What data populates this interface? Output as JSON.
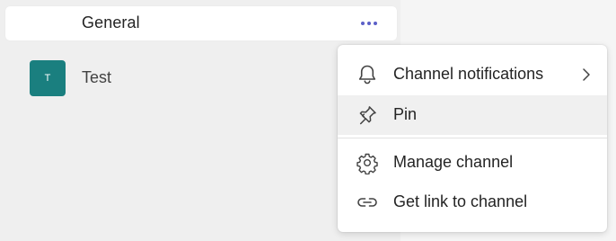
{
  "channels": {
    "general": {
      "name": "General",
      "more_icon": "more-horizontal-icon"
    }
  },
  "team": {
    "avatar_letter": "T",
    "name": "Test",
    "avatar_color": "#1a7f7f"
  },
  "context_menu": {
    "items": [
      {
        "label": "Channel notifications",
        "icon": "bell-icon",
        "has_submenu": true
      },
      {
        "label": "Pin",
        "icon": "pin-icon",
        "hovered": true
      },
      {
        "label": "Manage channel",
        "icon": "gear-icon"
      },
      {
        "label": "Get link to channel",
        "icon": "link-icon"
      }
    ]
  },
  "colors": {
    "accent": "#5b5fc7",
    "menu_hover": "#f0f0f0"
  }
}
